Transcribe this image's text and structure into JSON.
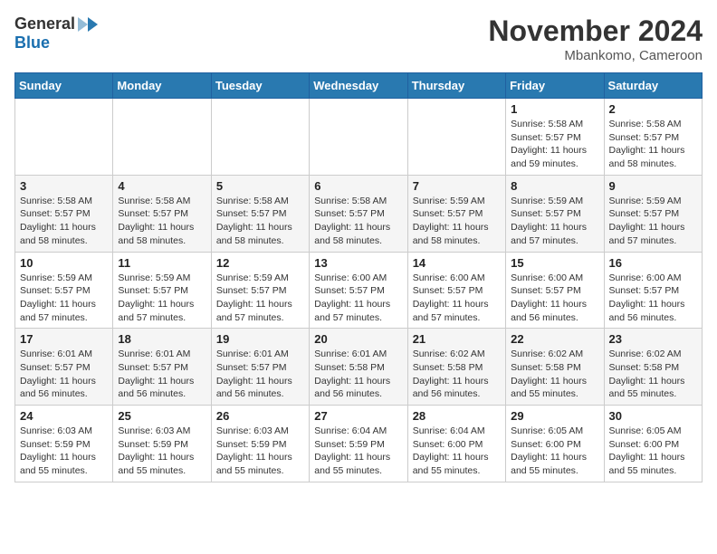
{
  "header": {
    "logo_general": "General",
    "logo_blue": "Blue",
    "month_title": "November 2024",
    "location": "Mbankomo, Cameroon"
  },
  "weekdays": [
    "Sunday",
    "Monday",
    "Tuesday",
    "Wednesday",
    "Thursday",
    "Friday",
    "Saturday"
  ],
  "rows": [
    [
      {
        "day": "",
        "sunrise": "",
        "sunset": "",
        "daylight": ""
      },
      {
        "day": "",
        "sunrise": "",
        "sunset": "",
        "daylight": ""
      },
      {
        "day": "",
        "sunrise": "",
        "sunset": "",
        "daylight": ""
      },
      {
        "day": "",
        "sunrise": "",
        "sunset": "",
        "daylight": ""
      },
      {
        "day": "",
        "sunrise": "",
        "sunset": "",
        "daylight": ""
      },
      {
        "day": "1",
        "sunrise": "Sunrise: 5:58 AM",
        "sunset": "Sunset: 5:57 PM",
        "daylight": "Daylight: 11 hours and 59 minutes."
      },
      {
        "day": "2",
        "sunrise": "Sunrise: 5:58 AM",
        "sunset": "Sunset: 5:57 PM",
        "daylight": "Daylight: 11 hours and 58 minutes."
      }
    ],
    [
      {
        "day": "3",
        "sunrise": "Sunrise: 5:58 AM",
        "sunset": "Sunset: 5:57 PM",
        "daylight": "Daylight: 11 hours and 58 minutes."
      },
      {
        "day": "4",
        "sunrise": "Sunrise: 5:58 AM",
        "sunset": "Sunset: 5:57 PM",
        "daylight": "Daylight: 11 hours and 58 minutes."
      },
      {
        "day": "5",
        "sunrise": "Sunrise: 5:58 AM",
        "sunset": "Sunset: 5:57 PM",
        "daylight": "Daylight: 11 hours and 58 minutes."
      },
      {
        "day": "6",
        "sunrise": "Sunrise: 5:58 AM",
        "sunset": "Sunset: 5:57 PM",
        "daylight": "Daylight: 11 hours and 58 minutes."
      },
      {
        "day": "7",
        "sunrise": "Sunrise: 5:59 AM",
        "sunset": "Sunset: 5:57 PM",
        "daylight": "Daylight: 11 hours and 58 minutes."
      },
      {
        "day": "8",
        "sunrise": "Sunrise: 5:59 AM",
        "sunset": "Sunset: 5:57 PM",
        "daylight": "Daylight: 11 hours and 57 minutes."
      },
      {
        "day": "9",
        "sunrise": "Sunrise: 5:59 AM",
        "sunset": "Sunset: 5:57 PM",
        "daylight": "Daylight: 11 hours and 57 minutes."
      }
    ],
    [
      {
        "day": "10",
        "sunrise": "Sunrise: 5:59 AM",
        "sunset": "Sunset: 5:57 PM",
        "daylight": "Daylight: 11 hours and 57 minutes."
      },
      {
        "day": "11",
        "sunrise": "Sunrise: 5:59 AM",
        "sunset": "Sunset: 5:57 PM",
        "daylight": "Daylight: 11 hours and 57 minutes."
      },
      {
        "day": "12",
        "sunrise": "Sunrise: 5:59 AM",
        "sunset": "Sunset: 5:57 PM",
        "daylight": "Daylight: 11 hours and 57 minutes."
      },
      {
        "day": "13",
        "sunrise": "Sunrise: 6:00 AM",
        "sunset": "Sunset: 5:57 PM",
        "daylight": "Daylight: 11 hours and 57 minutes."
      },
      {
        "day": "14",
        "sunrise": "Sunrise: 6:00 AM",
        "sunset": "Sunset: 5:57 PM",
        "daylight": "Daylight: 11 hours and 57 minutes."
      },
      {
        "day": "15",
        "sunrise": "Sunrise: 6:00 AM",
        "sunset": "Sunset: 5:57 PM",
        "daylight": "Daylight: 11 hours and 56 minutes."
      },
      {
        "day": "16",
        "sunrise": "Sunrise: 6:00 AM",
        "sunset": "Sunset: 5:57 PM",
        "daylight": "Daylight: 11 hours and 56 minutes."
      }
    ],
    [
      {
        "day": "17",
        "sunrise": "Sunrise: 6:01 AM",
        "sunset": "Sunset: 5:57 PM",
        "daylight": "Daylight: 11 hours and 56 minutes."
      },
      {
        "day": "18",
        "sunrise": "Sunrise: 6:01 AM",
        "sunset": "Sunset: 5:57 PM",
        "daylight": "Daylight: 11 hours and 56 minutes."
      },
      {
        "day": "19",
        "sunrise": "Sunrise: 6:01 AM",
        "sunset": "Sunset: 5:57 PM",
        "daylight": "Daylight: 11 hours and 56 minutes."
      },
      {
        "day": "20",
        "sunrise": "Sunrise: 6:01 AM",
        "sunset": "Sunset: 5:58 PM",
        "daylight": "Daylight: 11 hours and 56 minutes."
      },
      {
        "day": "21",
        "sunrise": "Sunrise: 6:02 AM",
        "sunset": "Sunset: 5:58 PM",
        "daylight": "Daylight: 11 hours and 56 minutes."
      },
      {
        "day": "22",
        "sunrise": "Sunrise: 6:02 AM",
        "sunset": "Sunset: 5:58 PM",
        "daylight": "Daylight: 11 hours and 55 minutes."
      },
      {
        "day": "23",
        "sunrise": "Sunrise: 6:02 AM",
        "sunset": "Sunset: 5:58 PM",
        "daylight": "Daylight: 11 hours and 55 minutes."
      }
    ],
    [
      {
        "day": "24",
        "sunrise": "Sunrise: 6:03 AM",
        "sunset": "Sunset: 5:59 PM",
        "daylight": "Daylight: 11 hours and 55 minutes."
      },
      {
        "day": "25",
        "sunrise": "Sunrise: 6:03 AM",
        "sunset": "Sunset: 5:59 PM",
        "daylight": "Daylight: 11 hours and 55 minutes."
      },
      {
        "day": "26",
        "sunrise": "Sunrise: 6:03 AM",
        "sunset": "Sunset: 5:59 PM",
        "daylight": "Daylight: 11 hours and 55 minutes."
      },
      {
        "day": "27",
        "sunrise": "Sunrise: 6:04 AM",
        "sunset": "Sunset: 5:59 PM",
        "daylight": "Daylight: 11 hours and 55 minutes."
      },
      {
        "day": "28",
        "sunrise": "Sunrise: 6:04 AM",
        "sunset": "Sunset: 6:00 PM",
        "daylight": "Daylight: 11 hours and 55 minutes."
      },
      {
        "day": "29",
        "sunrise": "Sunrise: 6:05 AM",
        "sunset": "Sunset: 6:00 PM",
        "daylight": "Daylight: 11 hours and 55 minutes."
      },
      {
        "day": "30",
        "sunrise": "Sunrise: 6:05 AM",
        "sunset": "Sunset: 6:00 PM",
        "daylight": "Daylight: 11 hours and 55 minutes."
      }
    ]
  ]
}
